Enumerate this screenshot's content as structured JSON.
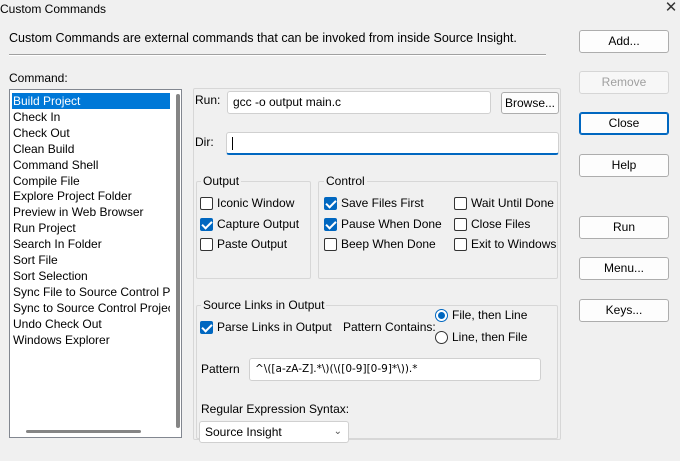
{
  "window": {
    "title": "Custom Commands"
  },
  "description": "Custom Commands are external commands that can be invoked from inside Source Insight.",
  "buttons": {
    "add": "Add...",
    "remove": "Remove",
    "close": "Close",
    "help": "Help",
    "run": "Run",
    "menu": "Menu...",
    "keys": "Keys...",
    "browse": "Browse..."
  },
  "command_list": {
    "label": "Command:",
    "selected_index": 0,
    "items": [
      "Build Project",
      "Check In",
      "Check Out",
      "Clean Build",
      "Command Shell",
      "Compile File",
      "Explore Project Folder",
      "Preview in Web Browser",
      "Run Project",
      "Search In Folder",
      "Sort File",
      "Sort Selection",
      "Sync File to Source Control Pro",
      "Sync to Source Control Project",
      "Undo Check Out",
      "Windows Explorer"
    ]
  },
  "run_field": {
    "label": "Run:",
    "value": "gcc -o output main.c"
  },
  "dir_field": {
    "label": "Dir:",
    "value": ""
  },
  "output_group": {
    "title": "Output",
    "options": [
      {
        "label": "Iconic Window",
        "checked": false
      },
      {
        "label": "Capture Output",
        "checked": true
      },
      {
        "label": "Paste Output",
        "checked": false
      }
    ]
  },
  "control_group": {
    "title": "Control",
    "options": [
      {
        "label": "Save Files First",
        "checked": true
      },
      {
        "label": "Pause When Done",
        "checked": true
      },
      {
        "label": "Beep When Done",
        "checked": false
      },
      {
        "label": "Wait Until Done",
        "checked": false
      },
      {
        "label": "Close Files",
        "checked": false
      },
      {
        "label": "Exit to Windows",
        "checked": false
      }
    ]
  },
  "source_links": {
    "title": "Source Links in Output",
    "parse_links": {
      "label": "Parse Links in Output",
      "checked": true
    },
    "pattern_contains_label": "Pattern Contains:",
    "pattern_options": [
      {
        "label": "File, then Line",
        "checked": true
      },
      {
        "label": "Line, then File",
        "checked": false
      }
    ],
    "pattern_label": "Pattern",
    "pattern_value": "^\\([a-zA-Z].*\\)(\\([0-9][0-9]*\\)).*",
    "regex_syntax_label": "Regular Expression Syntax:",
    "regex_syntax_value": "Source Insight"
  },
  "colors": {
    "accent": "#0067c0",
    "selection": "#0078d7"
  }
}
